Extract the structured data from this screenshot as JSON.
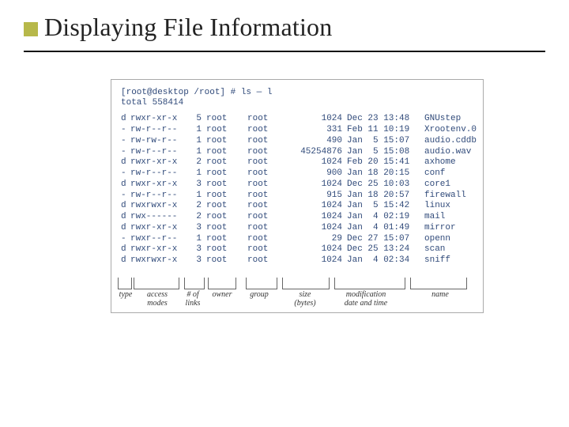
{
  "title": "Displaying File Information",
  "terminal": {
    "prompt": "[root@desktop /root] # ls — l",
    "total_line": "total 558414",
    "columns": {
      "type": "type",
      "perm": "access\nmodes",
      "links": "# of\nlinks",
      "owner": "owner",
      "group": "group",
      "size": "size\n(bytes)",
      "date": "modification\ndate and time",
      "name": "name"
    },
    "rows": [
      {
        "type": "d",
        "perm": "rwxr-xr-x",
        "links": "5",
        "owner": "root",
        "group": "root",
        "size": "1024",
        "date": "Dec 23 13:48",
        "name": "GNUstep"
      },
      {
        "type": "-",
        "perm": "rw-r--r--",
        "links": "1",
        "owner": "root",
        "group": "root",
        "size": "331",
        "date": "Feb 11 10:19",
        "name": "Xrootenv.0"
      },
      {
        "type": "-",
        "perm": "rw-rw-r--",
        "links": "1",
        "owner": "root",
        "group": "root",
        "size": "490",
        "date": "Jan  5 15:07",
        "name": "audio.cddb"
      },
      {
        "type": "-",
        "perm": "rw-r--r--",
        "links": "1",
        "owner": "root",
        "group": "root",
        "size": "45254876",
        "date": "Jan  5 15:08",
        "name": "audio.wav"
      },
      {
        "type": "d",
        "perm": "rwxr-xr-x",
        "links": "2",
        "owner": "root",
        "group": "root",
        "size": "1024",
        "date": "Feb 20 15:41",
        "name": "axhome"
      },
      {
        "type": "-",
        "perm": "rw-r--r--",
        "links": "1",
        "owner": "root",
        "group": "root",
        "size": "900",
        "date": "Jan 18 20:15",
        "name": "conf"
      },
      {
        "type": "d",
        "perm": "rwxr-xr-x",
        "links": "3",
        "owner": "root",
        "group": "root",
        "size": "1024",
        "date": "Dec 25 10:03",
        "name": "core1"
      },
      {
        "type": "-",
        "perm": "rw-r--r--",
        "links": "1",
        "owner": "root",
        "group": "root",
        "size": "915",
        "date": "Jan 18 20:57",
        "name": "firewall"
      },
      {
        "type": "d",
        "perm": "rwxrwxr-x",
        "links": "2",
        "owner": "root",
        "group": "root",
        "size": "1024",
        "date": "Jan  5 15:42",
        "name": "linux"
      },
      {
        "type": "d",
        "perm": "rwx------",
        "links": "2",
        "owner": "root",
        "group": "root",
        "size": "1024",
        "date": "Jan  4 02:19",
        "name": "mail"
      },
      {
        "type": "d",
        "perm": "rwxr-xr-x",
        "links": "3",
        "owner": "root",
        "group": "root",
        "size": "1024",
        "date": "Jan  4 01:49",
        "name": "mirror"
      },
      {
        "type": "-",
        "perm": "rwxr--r--",
        "links": "1",
        "owner": "root",
        "group": "root",
        "size": "29",
        "date": "Dec 27 15:07",
        "name": "openn"
      },
      {
        "type": "d",
        "perm": "rwxr-xr-x",
        "links": "3",
        "owner": "root",
        "group": "root",
        "size": "1024",
        "date": "Dec 25 13:24",
        "name": "scan"
      },
      {
        "type": "d",
        "perm": "rwxrwxr-x",
        "links": "3",
        "owner": "root",
        "group": "root",
        "size": "1024",
        "date": "Jan  4 02:34",
        "name": "sniff"
      }
    ]
  }
}
